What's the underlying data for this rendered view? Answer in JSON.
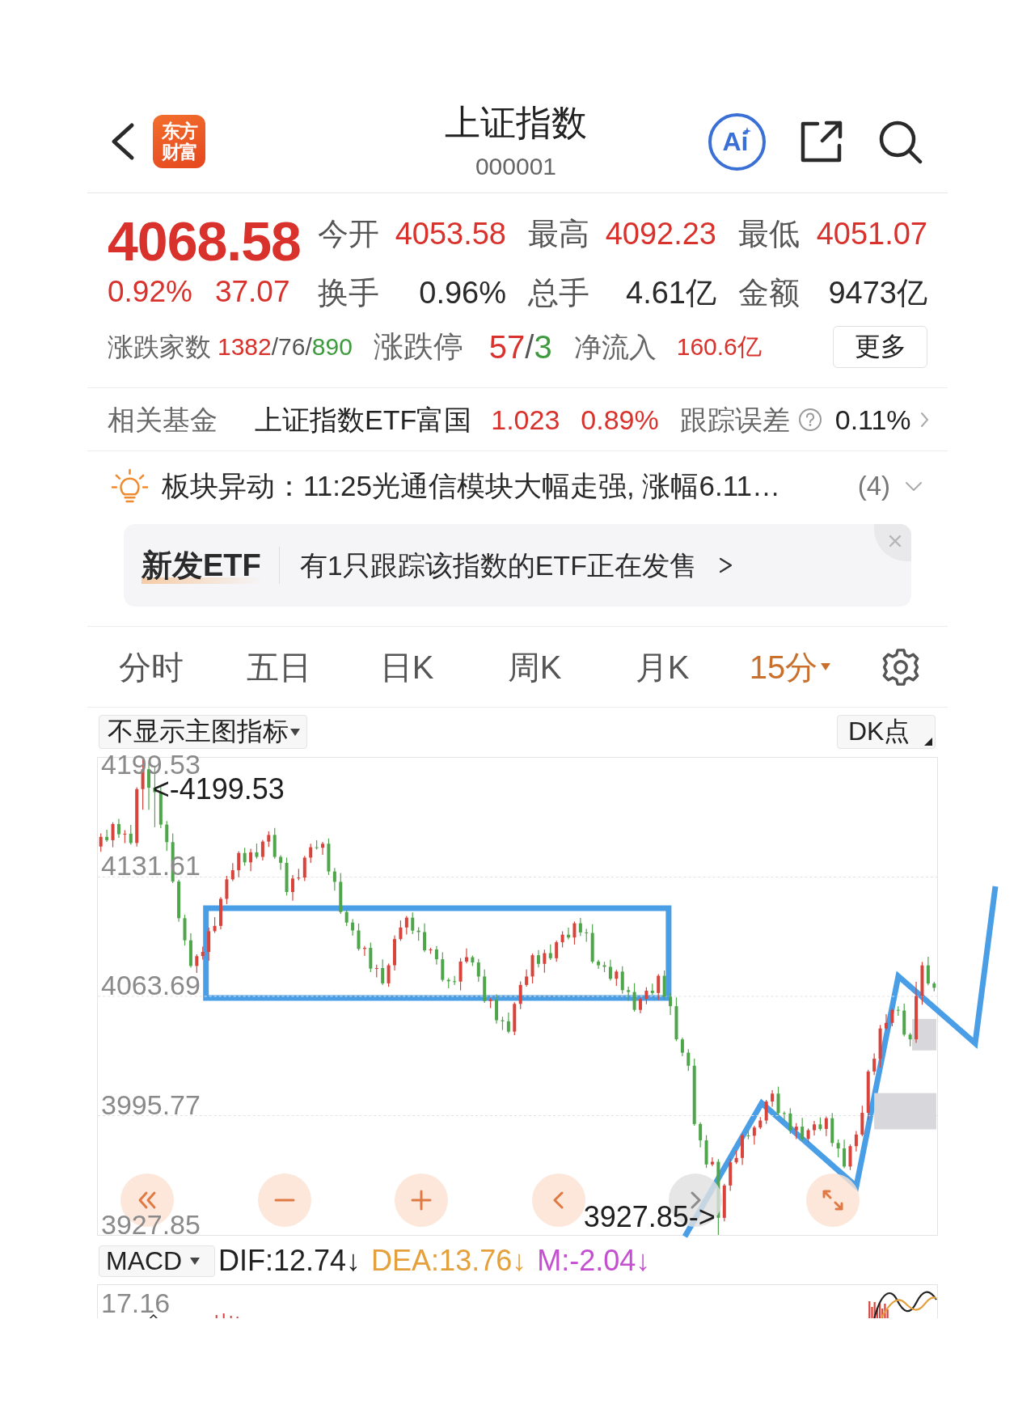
{
  "header": {
    "logo": [
      "东方",
      "财富"
    ],
    "title": "上证指数",
    "code": "000001",
    "ai_label": "Ai"
  },
  "quote": {
    "rising": true,
    "price": "4068.58",
    "change_percent": "0.92%",
    "change": "37.07",
    "stats": [
      {
        "label": "今开",
        "value": "4053.58",
        "kind": "price"
      },
      {
        "label": "最高",
        "value": "4092.23",
        "kind": "price"
      },
      {
        "label": "最低",
        "value": "4051.07",
        "kind": "price"
      },
      {
        "label": "换手",
        "value": "0.96%",
        "kind": "volume"
      },
      {
        "label": "总手",
        "value": "4.61亿",
        "kind": "volume"
      },
      {
        "label": "金额",
        "value": "9473亿",
        "kind": "volume"
      }
    ],
    "breadth": {
      "label": "涨跌家数",
      "parts": [
        {
          "kind": "up",
          "text": "1382"
        },
        {
          "kind": "flat",
          "text": "/76/"
        },
        {
          "kind": "down",
          "text": "890"
        }
      ]
    },
    "limits": {
      "label": "涨跌停",
      "parts": [
        {
          "kind": "up",
          "text": "57"
        },
        {
          "kind": "flat",
          "text": "/"
        },
        {
          "kind": "down",
          "text": "3"
        }
      ]
    },
    "net_inflow": {
      "label": "净流入",
      "value": "160.6亿"
    },
    "more_button": "更多"
  },
  "fund": {
    "label": "相关基金",
    "name": "上证指数ETF富国",
    "rising": true,
    "price": "1.023",
    "change_percent": "0.89%",
    "tracking_label": "跟踪误差",
    "tracking_error": "0.11%"
  },
  "alert": {
    "text": "板块异动：11:25光通信模块大幅走强, 涨幅6.11…",
    "count": "(4)",
    "expanded": false
  },
  "etf_banner": {
    "tag": "新发ETF",
    "text": "有1只跟踪该指数的ETF正在发售"
  },
  "tabs": [
    {
      "label": "分时",
      "selected": false,
      "dropdown": false
    },
    {
      "label": "五日",
      "selected": false,
      "dropdown": false
    },
    {
      "label": "日K",
      "selected": false,
      "dropdown": false
    },
    {
      "label": "周K",
      "selected": false,
      "dropdown": false
    },
    {
      "label": "月K",
      "selected": false,
      "dropdown": false
    },
    {
      "label": "15分",
      "selected": true,
      "dropdown": true
    }
  ],
  "chart": {
    "indicator": "不显示主图指标",
    "dk_button": "DK点",
    "range_high_label": "4199.53",
    "range_low_label": "3927.85",
    "high_marker": "<-4199.53",
    "low_marker": "3927.85->",
    "controls": [
      {
        "kind": "rewind",
        "disabled": false
      },
      {
        "kind": "zoom_out",
        "disabled": false
      },
      {
        "kind": "zoom_in",
        "disabled": false
      },
      {
        "kind": "back",
        "disabled": false
      },
      {
        "kind": "forward",
        "disabled": true
      },
      {
        "kind": "fullscreen",
        "disabled": false
      }
    ],
    "chart_data": {
      "type": "candlestick",
      "grid": true,
      "ylim": [
        3927.85,
        4199.53
      ],
      "yticks": [
        3995.77,
        4063.69,
        4131.61
      ],
      "ohlc": [
        [
          4149,
          4156.5,
          4146,
          4154.5
        ],
        [
          4154.5,
          4158.5,
          4151.6,
          4152.6
        ],
        [
          4152.6,
          4162.8,
          4148.6,
          4161.8
        ],
        [
          4161.8,
          4164.8,
          4154,
          4156
        ],
        [
          4156,
          4158.3,
          4151,
          4156.3
        ],
        [
          4156.3,
          4161.3,
          4150,
          4151
        ],
        [
          4151,
          4182.7,
          4149,
          4181.7
        ],
        [
          4181.7,
          4199.53,
          4170,
          4193
        ],
        [
          4193,
          4197,
          4170,
          4182.5
        ],
        [
          4182.5,
          4194,
          4160,
          4179.9
        ],
        [
          4179.9,
          4182.9,
          4159.5,
          4161.5
        ],
        [
          4161.5,
          4163.5,
          4146.5,
          4151.5
        ],
        [
          4151.5,
          4156.5,
          4128.1,
          4129.1
        ],
        [
          4129.1,
          4130.1,
          4106.2,
          4108.2
        ],
        [
          4108.2,
          4110.2,
          4092.6,
          4095.6
        ],
        [
          4095.6,
          4099.6,
          4080,
          4081
        ],
        [
          4081,
          4087.6,
          4077,
          4086.6
        ],
        [
          4086.6,
          4092,
          4084.6,
          4089
        ],
        [
          4089,
          4102.8,
          4084,
          4100.8
        ],
        [
          4100.8,
          4108.8,
          4099.8,
          4103.8
        ],
        [
          4103.8,
          4120.2,
          4101.8,
          4119.2
        ],
        [
          4119.2,
          4132.3,
          4116.2,
          4130.3
        ],
        [
          4130.3,
          4139.5,
          4129.3,
          4135.5
        ],
        [
          4135.5,
          4146.3,
          4131.5,
          4145.3
        ],
        [
          4145.3,
          4148.3,
          4138,
          4140
        ],
        [
          4140,
          4147.7,
          4135,
          4145.7
        ],
        [
          4145.7,
          4150.7,
          4142.1,
          4143.1
        ],
        [
          4143.1,
          4152.8,
          4141.1,
          4151.8
        ],
        [
          4151.8,
          4157.6,
          4148.8,
          4155.6
        ],
        [
          4155.6,
          4159.6,
          4142.1,
          4143.1
        ],
        [
          4143.1,
          4144.1,
          4135.7,
          4139.7
        ],
        [
          4139.7,
          4142.7,
          4121.1,
          4123.1
        ],
        [
          4123.1,
          4132.8,
          4118.1,
          4130.8
        ],
        [
          4130.8,
          4136.3,
          4129.8,
          4131.3
        ],
        [
          4131.3,
          4143.7,
          4129.3,
          4142.7
        ],
        [
          4142.7,
          4150.6,
          4139.7,
          4148.6
        ],
        [
          4148.6,
          4152.6,
          4147.3,
          4148.3
        ],
        [
          4148.3,
          4151.6,
          4144.3,
          4150.6
        ],
        [
          4150.6,
          4153.6,
          4132.8,
          4134.8
        ],
        [
          4134.8,
          4136.8,
          4123.9,
          4128.9
        ],
        [
          4128.9,
          4133.9,
          4110.7,
          4111.7
        ],
        [
          4111.7,
          4112.7,
          4103.7,
          4105.7
        ],
        [
          4105.7,
          4107.7,
          4098.2,
          4101.2
        ],
        [
          4101.2,
          4105.2,
          4089.7,
          4090.7
        ],
        [
          4090.7,
          4092.3,
          4086.7,
          4091.3
        ],
        [
          4091.3,
          4094.3,
          4077.5,
          4079.5
        ],
        [
          4079.5,
          4081.8,
          4074.5,
          4079.8
        ],
        [
          4079.8,
          4084.8,
          4070.1,
          4071.1
        ],
        [
          4071.1,
          4082.4,
          4069.1,
          4081.4
        ],
        [
          4081.4,
          4098.3,
          4078.4,
          4096.3
        ],
        [
          4096.3,
          4106.9,
          4095.3,
          4102.9
        ],
        [
          4102.9,
          4109.5,
          4098.9,
          4108.5
        ],
        [
          4108.5,
          4111.5,
          4099.1,
          4101.1
        ],
        [
          4101.1,
          4103.1,
          4095.3,
          4100.3
        ],
        [
          4100.3,
          4105.3,
          4088.9,
          4089.9
        ],
        [
          4089.9,
          4091.4,
          4087.9,
          4090.4
        ],
        [
          4090.4,
          4092.4,
          4081.8,
          4084.8
        ],
        [
          4084.8,
          4088.8,
          4072.1,
          4073.1
        ],
        [
          4073.1,
          4074.1,
          4068.3,
          4072.3
        ],
        [
          4072.3,
          4075.3,
          4070.1,
          4072.1
        ],
        [
          4072.1,
          4085.5,
          4067.1,
          4083.5
        ],
        [
          4083.5,
          4091,
          4082.5,
          4086
        ],
        [
          4086,
          4087,
          4081,
          4083
        ],
        [
          4083,
          4085,
          4072,
          4075
        ],
        [
          4075,
          4079,
          4060,
          4061
        ],
        [
          4061,
          4062.8,
          4057,
          4061.8
        ],
        [
          4061.8,
          4064.8,
          4048.1,
          4050.1
        ],
        [
          4050.1,
          4052.1,
          4044.5,
          4049.5
        ],
        [
          4049.5,
          4054.5,
          4042.6,
          4043.6
        ],
        [
          4043.6,
          4060.4,
          4041.6,
          4059.4
        ],
        [
          4059.4,
          4072.2,
          4056.4,
          4070.2
        ],
        [
          4070.2,
          4079,
          4069.2,
          4075
        ],
        [
          4075,
          4088.1,
          4071,
          4087.1
        ],
        [
          4087.1,
          4090.1,
          4080.2,
          4082.2
        ],
        [
          4082.2,
          4090.3,
          4077.2,
          4088.3
        ],
        [
          4088.3,
          4093.3,
          4084.4,
          4085.4
        ],
        [
          4085.4,
          4095.5,
          4083.4,
          4094.5
        ],
        [
          4094.5,
          4100.8,
          4091.5,
          4098.8
        ],
        [
          4098.8,
          4102.8,
          4096.2,
          4097.2
        ],
        [
          4097.2,
          4106.3,
          4093.2,
          4105.3
        ],
        [
          4105.3,
          4108.3,
          4098.1,
          4100.1
        ],
        [
          4100.1,
          4102.1,
          4094.8,
          4099.8
        ],
        [
          4099.8,
          4104.8,
          4082.5,
          4083.5
        ],
        [
          4083.5,
          4084.5,
          4079.4,
          4081.4
        ],
        [
          4081.4,
          4083.4,
          4077.5,
          4080.5
        ],
        [
          4080.5,
          4084.5,
          4072.7,
          4073.7
        ],
        [
          4073.7,
          4078.8,
          4069.7,
          4077.8
        ],
        [
          4077.8,
          4080.8,
          4065.2,
          4067.2
        ],
        [
          4067.2,
          4069.2,
          4061.2,
          4066.2
        ],
        [
          4066.2,
          4071.2,
          4055,
          4056
        ],
        [
          4056,
          4063.2,
          4054,
          4062.2
        ],
        [
          4062.2,
          4068.9,
          4059.2,
          4066.9
        ],
        [
          4066.9,
          4070.9,
          4064.6,
          4065.6
        ],
        [
          4065.6,
          4076.4,
          4061.6,
          4075.4
        ],
        [
          4075.4,
          4078.4,
          4061.5,
          4063.5
        ],
        [
          4063.5,
          4065.5,
          4053.1,
          4058.1
        ],
        [
          4058.1,
          4063.1,
          4038.2,
          4039.2
        ],
        [
          4039.2,
          4040.2,
          4029.6,
          4031.6
        ],
        [
          4031.6,
          4033.6,
          4021.2,
          4024.2
        ],
        [
          4024.2,
          4028.2,
          3990,
          3991
        ],
        [
          3991,
          3992,
          3977.7,
          3981.7
        ],
        [
          3981.7,
          3984.7,
          3966,
          3968
        ],
        [
          3968,
          3972,
          3967,
          3969.5
        ],
        [
          3969.5,
          3971,
          3927.85,
          3937.6
        ],
        [
          3937.6,
          3957,
          3935.6,
          3956
        ],
        [
          3956,
          3971.2,
          3953,
          3969.2
        ],
        [
          3969.2,
          3975.7,
          3968.2,
          3971.7
        ],
        [
          3971.7,
          3985.5,
          3967.7,
          3984.5
        ],
        [
          3984.5,
          3987.5,
          3982.3,
          3984.3
        ],
        [
          3984.3,
          3990,
          3979.3,
          3989
        ],
        [
          3989,
          3995,
          3988,
          3993
        ],
        [
          3993,
          4004.8,
          3991,
          4003.8
        ],
        [
          4003.8,
          4010.3,
          4000.8,
          4008.3
        ],
        [
          4008.3,
          4012.3,
          3996.2,
          3997.2
        ],
        [
          3997.2,
          3998.2,
          3993,
          3997
        ],
        [
          3997,
          4000,
          3985.4,
          3987.4
        ],
        [
          3987.4,
          3991.5,
          3982.4,
          3989.5
        ],
        [
          3989.5,
          3994.5,
          3981.5,
          3982.5
        ],
        [
          3982.5,
          3988.5,
          3980.5,
          3987.5
        ],
        [
          3987.5,
          3992.8,
          3984.5,
          3990.8
        ],
        [
          3990.8,
          3994.8,
          3987.2,
          3988.2
        ],
        [
          3988.2,
          3995.3,
          3984.2,
          3994.3
        ],
        [
          3994.3,
          3997.3,
          3978.2,
          3980.2
        ],
        [
          3980.2,
          3982.2,
          3972.1,
          3977.1
        ],
        [
          3977.1,
          3982.1,
          3965.8,
          3966.8
        ],
        [
          3966.8,
          3979.4,
          3964.8,
          3978.4
        ],
        [
          3978.4,
          3987,
          3975.4,
          3985
        ],
        [
          3985,
          4001.4,
          3984,
          3997.4
        ],
        [
          3997.4,
          4021.9,
          3993.4,
          4020.9
        ],
        [
          4020.9,
          4031.2,
          4018.9,
          4028.2
        ],
        [
          4028.2,
          4047.4,
          4023.2,
          4045.4
        ],
        [
          4045.4,
          4053.6,
          4044.4,
          4048.6
        ],
        [
          4048.6,
          4057,
          4046.6,
          4056
        ],
        [
          4056,
          4058,
          4052.6,
          4055.6
        ],
        [
          4055.6,
          4059.6,
          4040.9,
          4041.9
        ],
        [
          4041.9,
          4042.9,
          4035.2,
          4039.2
        ],
        [
          4039.2,
          4072,
          4037.2,
          4063.9
        ],
        [
          4063.9,
          4083.3,
          4058.9,
          4081.3
        ],
        [
          4081.3,
          4086.3,
          4070,
          4071
        ],
        [
          4071,
          4072,
          4066.58,
          4068.58
        ]
      ]
    }
  },
  "macd": {
    "selector": "MACD",
    "values": [
      {
        "text": "DIF:12.74↓",
        "color": "#222222"
      },
      {
        "text": "DEA:13.76↓",
        "color": "#e4a03c"
      },
      {
        "text": "M:-2.04↓",
        "color": "#c44fd0"
      }
    ],
    "y_label": "17.16"
  }
}
